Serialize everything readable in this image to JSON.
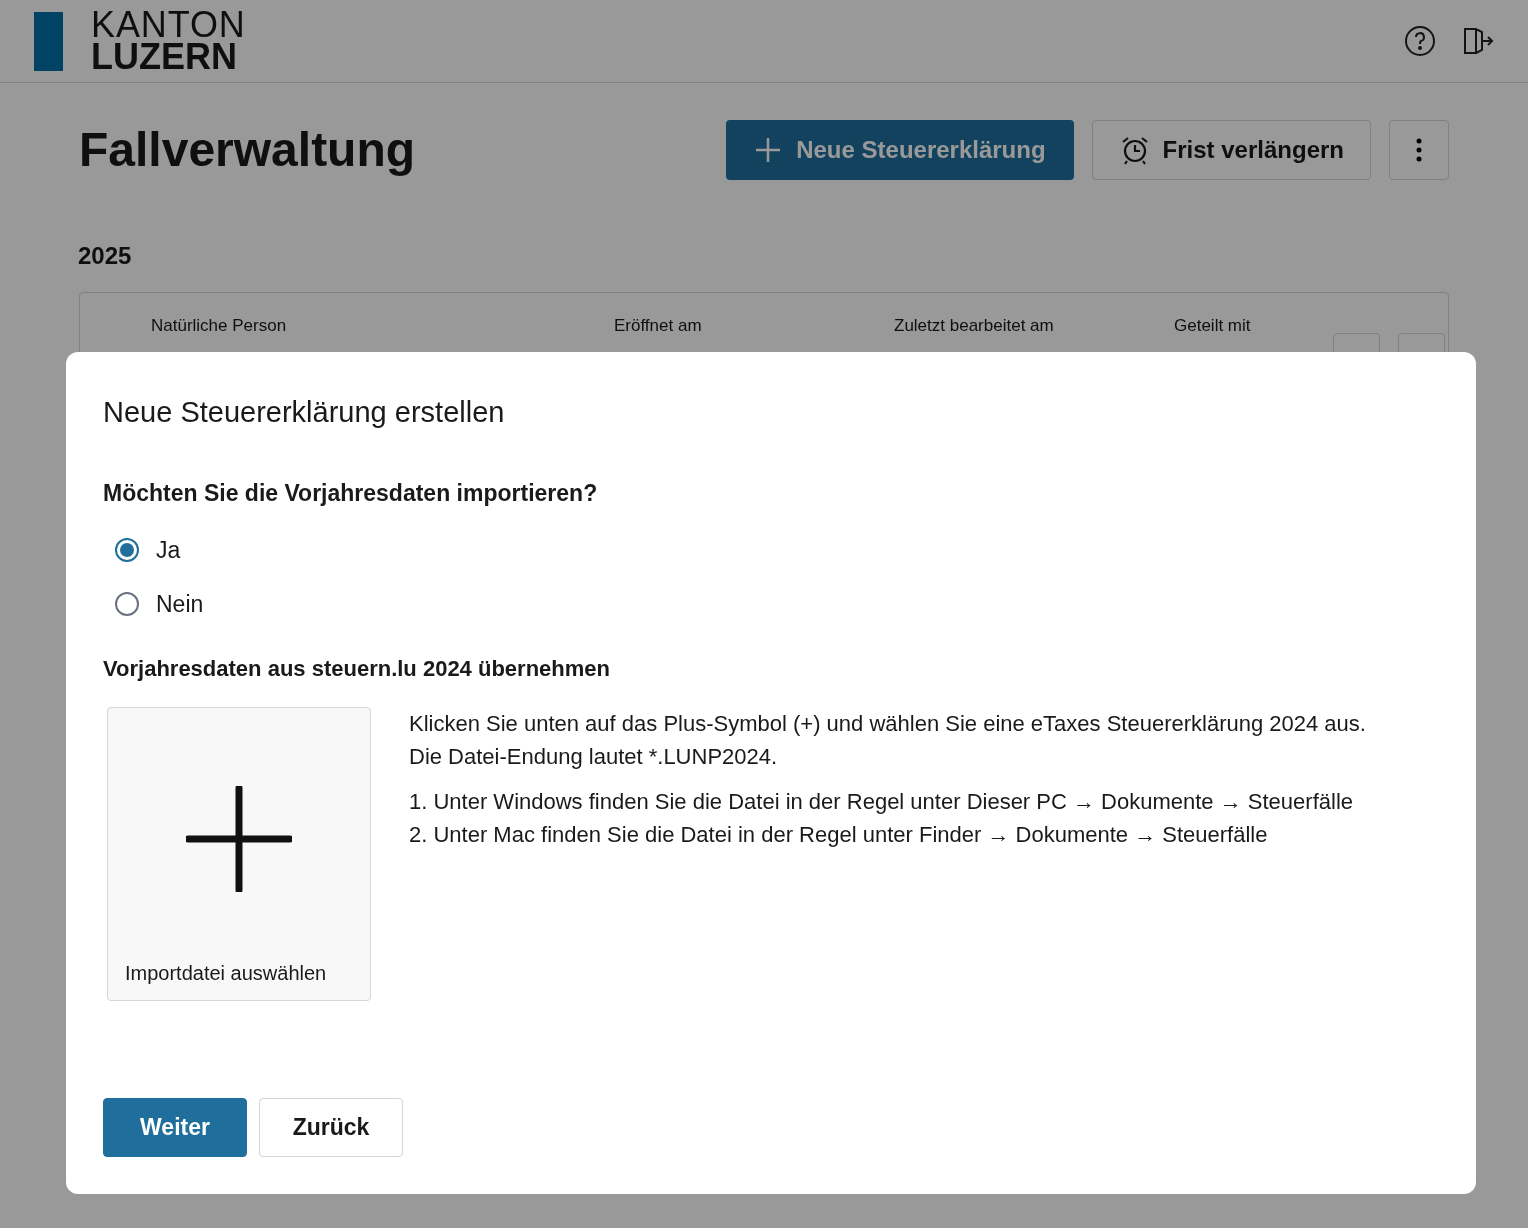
{
  "header": {
    "logo_line_1": "KANTON",
    "logo_line_2": "LUZERN"
  },
  "page": {
    "title": "Fallverwaltung",
    "actions": [
      {
        "kind": "primary",
        "label": "Neue Steuererklärung"
      },
      {
        "kind": "secondary",
        "label": "Frist verlängern"
      },
      {
        "kind": "menu"
      }
    ],
    "year": "2025",
    "case_columns": [
      "Natürliche Person",
      "Eröffnet am",
      "Zuletzt bearbeitet am",
      "Geteilt mit"
    ]
  },
  "dialog": {
    "title": "Neue Steuererklärung erstellen",
    "question": "Möchten Sie die Vorjahresdaten importieren?",
    "options": [
      {
        "label": "Ja",
        "selected": true
      },
      {
        "label": "Nein",
        "selected": false
      }
    ],
    "import_heading": "Vorjahresdaten aus steuern.lu 2024 übernehmen",
    "upload": {
      "label": "Importdatei auswählen"
    },
    "instructions": "Klicken Sie unten auf das Plus-Symbol (+) und wählen Sie eine eTaxes Steuererklärung 2024 aus. Die Datei-Endung lautet *.LUNP2024.",
    "steps": [
      "1. Unter Windows finden Sie die Datei in der Regel unter Dieser PC → Dokumente → Steuerfälle",
      "2. Unter Mac finden Sie die Datei in der Regel unter Finder → Dokumente → Steuerfälle"
    ],
    "buttons": [
      {
        "kind": "primary",
        "label": "Weiter"
      },
      {
        "kind": "secondary",
        "label": "Zurück"
      }
    ]
  }
}
